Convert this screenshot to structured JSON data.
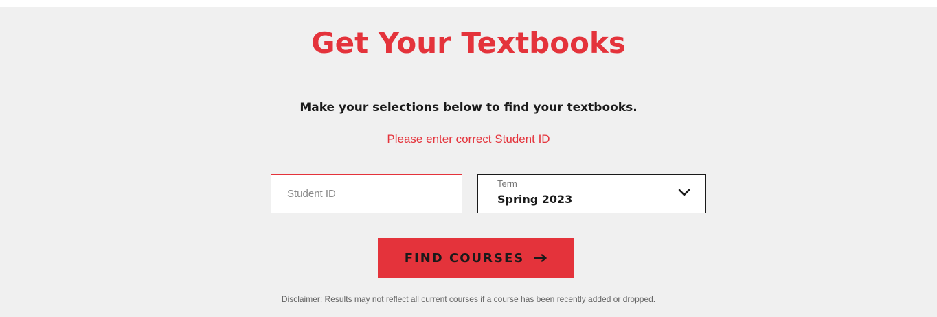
{
  "header": {
    "title": "Get Your Textbooks",
    "subtitle": "Make your selections below to find your textbooks."
  },
  "form": {
    "error_message": "Please enter correct Student ID",
    "student_id": {
      "placeholder": "Student ID",
      "value": ""
    },
    "term": {
      "label": "Term",
      "selected": "Spring 2023",
      "icon": "chevron-down-icon"
    },
    "submit": {
      "label": "FIND COURSES",
      "icon": "arrow-right-icon"
    }
  },
  "footer": {
    "disclaimer": "Disclaimer: Results may not reflect all current courses if a course has been recently added or dropped."
  },
  "colors": {
    "accent": "#e4333b",
    "panel_background": "#f0f0f0",
    "text_dark": "#1a1a1a"
  }
}
